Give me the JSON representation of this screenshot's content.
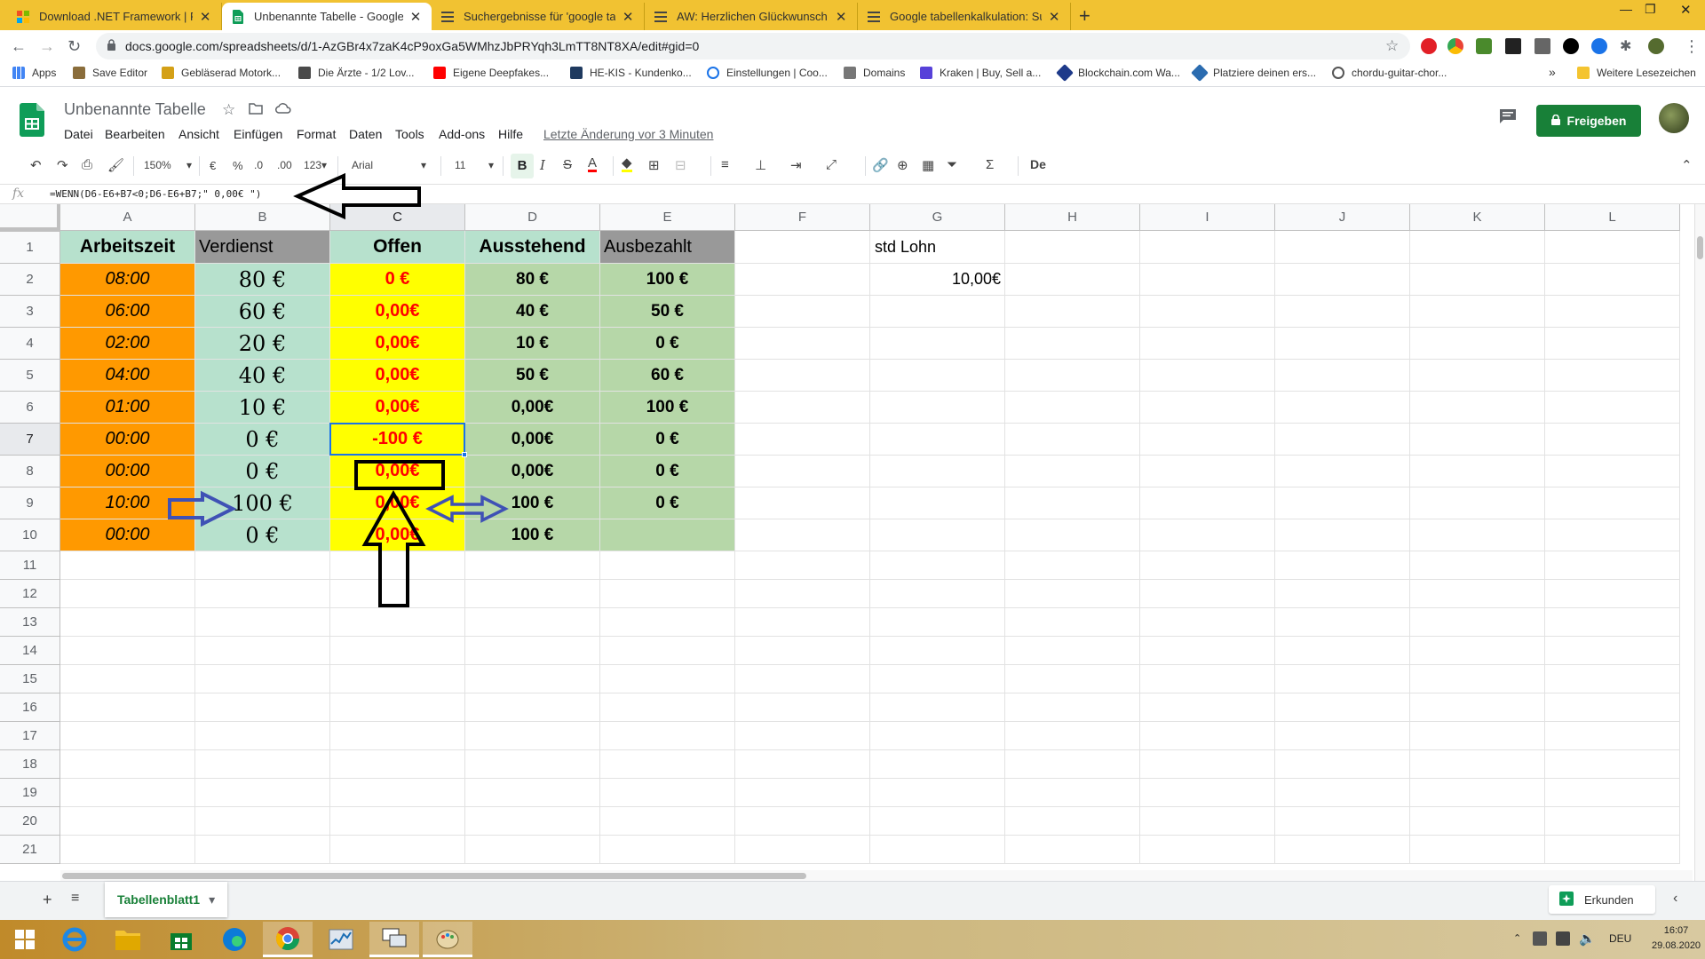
{
  "browser": {
    "tabs": [
      {
        "title": "Download .NET Framework | Free",
        "active": false
      },
      {
        "title": "Unbenannte Tabelle - Google Ta",
        "active": true
      },
      {
        "title": "Suchergebnisse für 'google tabel",
        "active": false
      },
      {
        "title": "AW: Herzlichen Glückwunsch zur",
        "active": false
      },
      {
        "title": "Google tabellenkalkulation: Sum",
        "active": false
      }
    ],
    "new_tab": "+",
    "url": "docs.google.com/spreadsheets/d/1-AzGBr4x7zaK4cP9oxGa5WMhzJbPRYqh3LmTT8NT8XA/edit#gid=0",
    "bookmarks": [
      "Apps",
      "Save Editor",
      "Gebläserad Motork...",
      "Die Ärzte - 1/2 Lov...",
      "Eigene Deepfakes...",
      "HE-KIS - Kundenko...",
      "Einstellungen | Coo...",
      "Domains",
      "Kraken | Buy, Sell a...",
      "Blockchain.com Wa...",
      "Platziere deinen ers...",
      "chordu-guitar-chor..."
    ],
    "bookmarks_more": "»",
    "other_bookmarks": "Weitere Lesezeichen"
  },
  "sheets": {
    "title": "Unbenannte Tabelle",
    "menu": [
      "Datei",
      "Bearbeiten",
      "Ansicht",
      "Einfügen",
      "Format",
      "Daten",
      "Tools",
      "Add-ons",
      "Hilfe"
    ],
    "last_edit": "Letzte Änderung vor 3 Minuten",
    "share_label": "Freigeben",
    "toolbar": {
      "zoom": "150%",
      "currency": "€",
      "percent": "%",
      "dec_less": ".0",
      "dec_more": ".00",
      "number_format": "123",
      "font": "Arial",
      "font_size": "11",
      "bold": "B",
      "italic": "I",
      "strike": "S",
      "text_color": "A",
      "function": "Σ",
      "input_tools": "De"
    },
    "formula_label": "fx",
    "formula": "=WENN(D6-E6+B7<0;D6-E6+B7;\" 0,00€ \")",
    "columns": [
      "A",
      "B",
      "C",
      "D",
      "E",
      "F",
      "G",
      "H",
      "I",
      "J",
      "K",
      "L"
    ],
    "rows": [
      "1",
      "2",
      "3",
      "4",
      "5",
      "6",
      "7",
      "8",
      "9",
      "10",
      "11",
      "12",
      "13",
      "14",
      "15",
      "16",
      "17",
      "18",
      "19",
      "20",
      "21"
    ],
    "table": {
      "headers": [
        "Arbeitszeit",
        "Verdienst",
        "Offen",
        "Ausstehend",
        "Ausbezahlt"
      ],
      "data": [
        [
          "08:00",
          "80 €",
          "0 €",
          "80 €",
          "100 €"
        ],
        [
          "06:00",
          "60 €",
          "0,00€",
          "40 €",
          "50 €"
        ],
        [
          "02:00",
          "20 €",
          "0,00€",
          "10 €",
          "0 €"
        ],
        [
          "04:00",
          "40 €",
          "0,00€",
          "50 €",
          "60 €"
        ],
        [
          "01:00",
          "10 €",
          "0,00€",
          "0,00€",
          "100 €"
        ],
        [
          "00:00",
          "0 €",
          "-100 €",
          "0,00€",
          "0 €"
        ],
        [
          "00:00",
          "0 €",
          "0,00€",
          "0,00€",
          "0 €"
        ],
        [
          "10:00",
          "100 €",
          "0,00€",
          "100 €",
          "0 €"
        ],
        [
          "00:00",
          "0 €",
          "0,00€",
          "100 €",
          ""
        ]
      ]
    },
    "extra": {
      "g1": "std Lohn",
      "g2": "10,00€"
    },
    "sheet_tab": "Tabellenblatt1",
    "explore_label": "Erkunden"
  },
  "taskbar": {
    "language": "DEU",
    "time": "16:07",
    "date": "29.08.2020"
  },
  "colors": {
    "tabstrip": "#f1c232",
    "orange": "#ff9900",
    "mint": "#b7e1cd",
    "gray": "#999999",
    "yellow": "#ffff00",
    "green": "#b6d7a8",
    "red_text": "#ff0000",
    "share": "#188038",
    "selection": "#1a73e8"
  }
}
